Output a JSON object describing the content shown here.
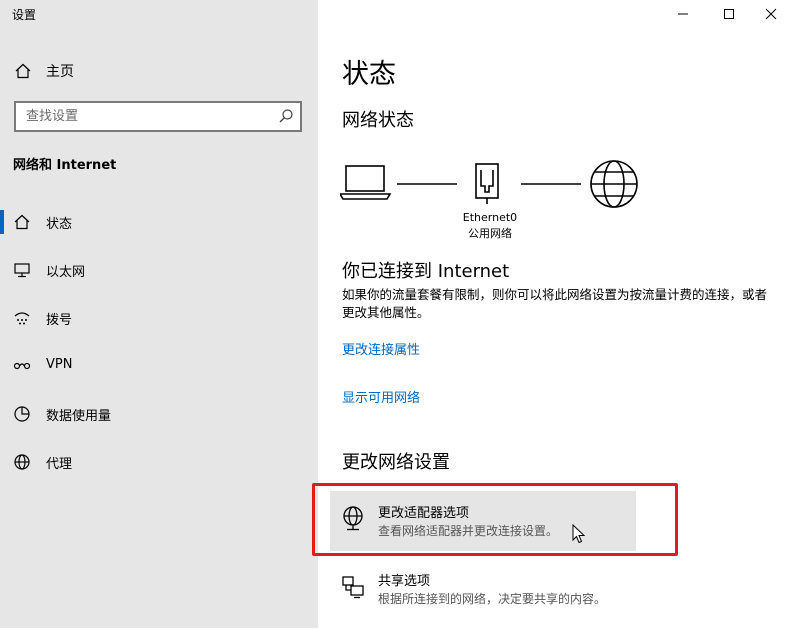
{
  "window": {
    "title": "设置"
  },
  "sidebar": {
    "home_label": "主页",
    "search_placeholder": "查找设置",
    "section_title": "网络和 Internet",
    "items": [
      {
        "label": "状态",
        "icon": "home-status-icon",
        "selected": true
      },
      {
        "label": "以太网",
        "icon": "ethernet-icon",
        "selected": false
      },
      {
        "label": "拨号",
        "icon": "dialup-icon",
        "selected": false
      },
      {
        "label": "VPN",
        "icon": "vpn-icon",
        "selected": false
      },
      {
        "label": "数据使用量",
        "icon": "data-usage-icon",
        "selected": false
      },
      {
        "label": "代理",
        "icon": "globe-icon",
        "selected": false
      }
    ]
  },
  "main": {
    "title": "状态",
    "network_status_heading": "网络状态",
    "adapter_name": "Ethernet0",
    "network_type": "公用网络",
    "connected_message": "你已连接到 Internet",
    "description": "如果你的流量套餐有限制，则你可以将此网络设置为按流量计费的连接，或者更改其他属性。",
    "link_change_properties": "更改连接属性",
    "link_show_networks": "显示可用网络",
    "change_settings_heading": "更改网络设置",
    "options": [
      {
        "title": "更改适配器选项",
        "subtitle": "查看网络适配器并更改连接设置。"
      },
      {
        "title": "共享选项",
        "subtitle": "根据所连接到的网络，决定要共享的内容。"
      }
    ]
  },
  "colors": {
    "accent": "#0067c0",
    "highlight": "#e31b1b",
    "sidebar_bg": "#e6e6e6"
  }
}
